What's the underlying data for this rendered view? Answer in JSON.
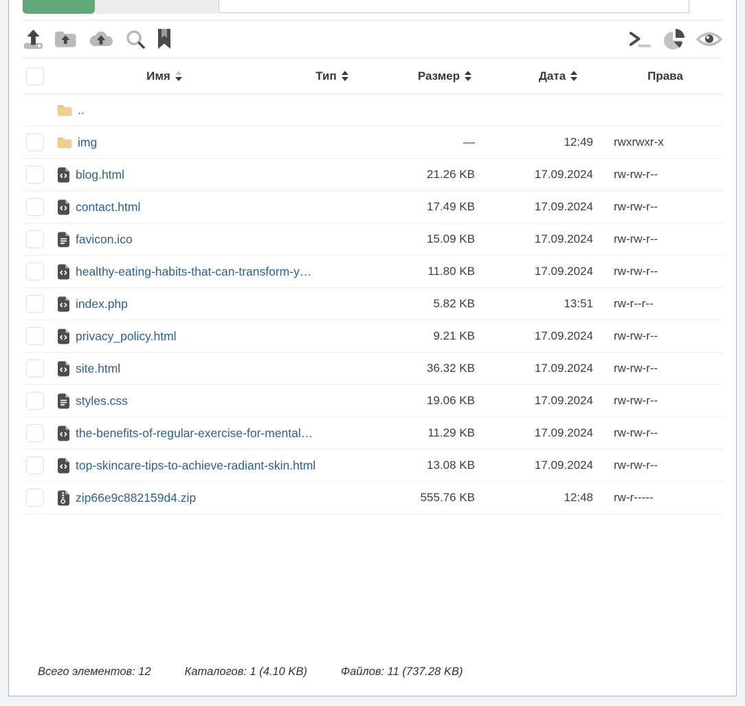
{
  "topbar": {
    "progress_percent": 37,
    "progress_color": "#5fa878"
  },
  "toolbar": {
    "left_icons": [
      "upload",
      "folder-upload",
      "cloud-upload",
      "search",
      "bookmark"
    ],
    "right_icons": [
      "terminal",
      "pie-chart",
      "eye"
    ]
  },
  "table": {
    "columns": {
      "name": {
        "label": "Имя",
        "sortable": true,
        "sorted": "desc"
      },
      "type": {
        "label": "Тип",
        "sortable": true,
        "sorted": "none"
      },
      "size": {
        "label": "Размер",
        "sortable": true,
        "sorted": "none"
      },
      "date": {
        "label": "Дата",
        "sortable": true,
        "sorted": "none"
      },
      "perms": {
        "label": "Права",
        "sortable": false,
        "sorted": "none"
      }
    },
    "rows": [
      {
        "icon": "folder",
        "name": "..",
        "size": "",
        "date": "",
        "perms": "",
        "checkbox": false,
        "underlined": false
      },
      {
        "icon": "folder",
        "name": "img",
        "size": "—",
        "date": "12:49",
        "perms": "rwxrwxr-x",
        "checkbox": true,
        "underlined": false
      },
      {
        "icon": "file-code",
        "name": "blog.html",
        "size": "21.26 KB",
        "date": "17.09.2024",
        "perms": "rw-rw-r--",
        "checkbox": true,
        "underlined": false
      },
      {
        "icon": "file-code",
        "name": "contact.html",
        "size": "17.49 KB",
        "date": "17.09.2024",
        "perms": "rw-rw-r--",
        "checkbox": true,
        "underlined": false
      },
      {
        "icon": "file-text",
        "name": "favicon.ico",
        "size": "15.09 KB",
        "date": "17.09.2024",
        "perms": "rw-rw-r--",
        "checkbox": true,
        "underlined": false
      },
      {
        "icon": "file-code",
        "name": "healthy-eating-habits-that-can-transform-y…",
        "size": "11.80 KB",
        "date": "17.09.2024",
        "perms": "rw-rw-r--",
        "checkbox": true,
        "underlined": false
      },
      {
        "icon": "file-code",
        "name": "index.php",
        "size": "5.82 KB",
        "date": "13:51",
        "perms": "rw-r--r--",
        "checkbox": true,
        "underlined": true
      },
      {
        "icon": "file-code",
        "name": "privacy_policy.html",
        "size": "9.21 KB",
        "date": "17.09.2024",
        "perms": "rw-rw-r--",
        "checkbox": true,
        "underlined": false
      },
      {
        "icon": "file-code",
        "name": "site.html",
        "size": "36.32 KB",
        "date": "17.09.2024",
        "perms": "rw-rw-r--",
        "checkbox": true,
        "underlined": true
      },
      {
        "icon": "file-text",
        "name": "styles.css",
        "size": "19.06 KB",
        "date": "17.09.2024",
        "perms": "rw-rw-r--",
        "checkbox": true,
        "underlined": false
      },
      {
        "icon": "file-code",
        "name": "the-benefits-of-regular-exercise-for-mental…",
        "size": "11.29 KB",
        "date": "17.09.2024",
        "perms": "rw-rw-r--",
        "checkbox": true,
        "underlined": false
      },
      {
        "icon": "file-code",
        "name": "top-skincare-tips-to-achieve-radiant-skin.html",
        "size": "13.08 KB",
        "date": "17.09.2024",
        "perms": "rw-rw-r--",
        "checkbox": true,
        "underlined": false
      },
      {
        "icon": "file-zip",
        "name": "zip66e9c882159d4.zip",
        "size": "555.76 KB",
        "date": "12:48",
        "perms": "rw-r-----",
        "checkbox": true,
        "underlined": false
      }
    ]
  },
  "footer": {
    "total_label": "Всего элементов: 12",
    "dirs_label": "Каталогов: 1 (4.10 KB)",
    "files_label": "Файлов: 11 (737.28 KB)"
  }
}
